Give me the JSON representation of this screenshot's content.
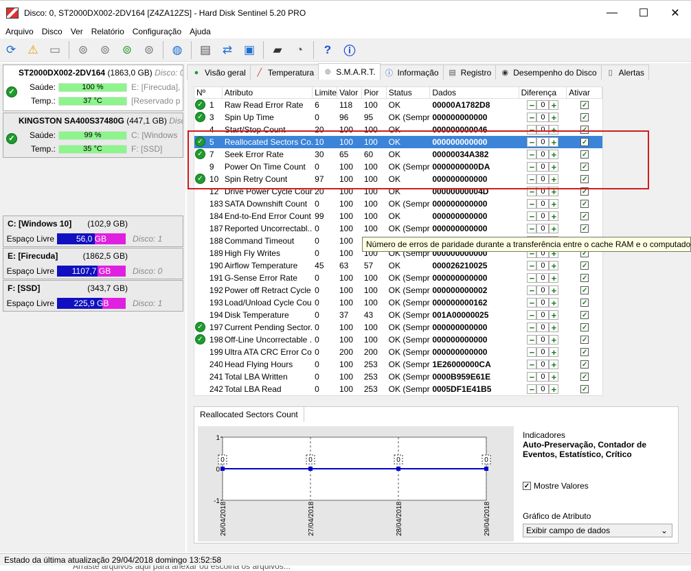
{
  "window": {
    "title": "Disco: 0, ST2000DX002-2DV164 [Z4ZA12ZS]  -  Hard Disk Sentinel 5.20 PRO",
    "minimize": "—",
    "maximize": "☐",
    "close": "✕"
  },
  "menu": [
    "Arquivo",
    "Disco",
    "Ver",
    "Relatório",
    "Configuração",
    "Ajuda"
  ],
  "disks": [
    {
      "name": "ST2000DX002-2DV164",
      "size": "(1863,0 GB)",
      "disk": "Disco: 0",
      "health_label": "Saúde:",
      "health": "100 %",
      "health_extra": "E: [Firecuda],",
      "temp_label": "Temp.:",
      "temp": "37 °C",
      "temp_extra": "[Reservado p"
    },
    {
      "name": "KINGSTON SA400S37480G",
      "size": "(447,1 GB)",
      "disk": "Disco",
      "health_label": "Saúde:",
      "health": "99 %",
      "health_extra": "C: [Windows",
      "temp_label": "Temp.:",
      "temp": "35 °C",
      "temp_extra": "F: [SSD]"
    }
  ],
  "volumes": [
    {
      "name": "C: [Windows 10]",
      "size": "(102,9 GB)",
      "free_label": "Espaço Livre",
      "free": "56,0 GB",
      "disk": "Disco: 1",
      "used_fraction": 0.46
    },
    {
      "name": "E: [Firecuda]",
      "size": "(1862,5 GB)",
      "free_label": "Espaço Livre",
      "free": "1107,7 GB",
      "disk": "Disco: 0",
      "used_fraction": 0.41
    },
    {
      "name": "F: [SSD]",
      "size": "(343,7 GB)",
      "free_label": "Espaço Livre",
      "free": "225,9 GB",
      "disk": "Disco: 1",
      "used_fraction": 0.34
    }
  ],
  "status_text": "Estado da última atualização 29/04/2018 domingo 13:52:58",
  "bottom_text": "Arraste arquivos aqui para anexar ou escolha os arquivos...",
  "tabs": [
    "Visão geral",
    "Temperatura",
    "S.M.A.R.T.",
    "Informação",
    "Registro",
    "Desempenho do Disco",
    "Alertas"
  ],
  "columns": [
    "Nº",
    "Atributo",
    "Limite",
    "Valor",
    "Pior",
    "Status",
    "Dados",
    "Diferença",
    "Ativar"
  ],
  "rows": [
    {
      "n": "1",
      "attr": "Raw Read Error Rate",
      "lim": "6",
      "val": "118",
      "pior": "100",
      "status": "OK",
      "data": "00000A1782D8",
      "ok": true
    },
    {
      "n": "3",
      "attr": "Spin Up Time",
      "lim": "0",
      "val": "96",
      "pior": "95",
      "status": "OK (Sempr...",
      "data": "000000000000",
      "ok": true
    },
    {
      "n": "4",
      "attr": "Start/Stop Count",
      "lim": "20",
      "val": "100",
      "pior": "100",
      "status": "OK",
      "data": "000000000046",
      "ok": false
    },
    {
      "n": "5",
      "attr": "Reallocated Sectors Co...",
      "lim": "10",
      "val": "100",
      "pior": "100",
      "status": "OK",
      "data": "000000000000",
      "ok": true,
      "sel": true
    },
    {
      "n": "7",
      "attr": "Seek Error Rate",
      "lim": "30",
      "val": "65",
      "pior": "60",
      "status": "OK",
      "data": "00000034A382",
      "ok": true
    },
    {
      "n": "9",
      "attr": "Power On Time Count",
      "lim": "0",
      "val": "100",
      "pior": "100",
      "status": "OK (Sempr...",
      "data": "0000000000DA",
      "ok": false
    },
    {
      "n": "10",
      "attr": "Spin Retry Count",
      "lim": "97",
      "val": "100",
      "pior": "100",
      "status": "OK",
      "data": "000000000000",
      "ok": true
    },
    {
      "n": "12",
      "attr": "Drive Power Cycle Count",
      "lim": "20",
      "val": "100",
      "pior": "100",
      "status": "OK",
      "data": "00000000004D",
      "ok": false
    },
    {
      "n": "183",
      "attr": "SATA Downshift Count",
      "lim": "0",
      "val": "100",
      "pior": "100",
      "status": "OK (Sempr...",
      "data": "000000000000",
      "ok": false
    },
    {
      "n": "184",
      "attr": "End-to-End Error Count",
      "lim": "99",
      "val": "100",
      "pior": "100",
      "status": "OK",
      "data": "000000000000",
      "ok": false
    },
    {
      "n": "187",
      "attr": "Reported Uncorrectabl...",
      "lim": "0",
      "val": "100",
      "pior": "100",
      "status": "OK (Sempr...",
      "data": "000000000000",
      "ok": false
    },
    {
      "n": "188",
      "attr": "Command Timeout",
      "lim": "0",
      "val": "100",
      "pior": "",
      "status": "",
      "data": "",
      "ok": false
    },
    {
      "n": "189",
      "attr": "High Fly Writes",
      "lim": "0",
      "val": "100",
      "pior": "100",
      "status": "OK (Sempr...",
      "data": "000000000000",
      "ok": false
    },
    {
      "n": "190",
      "attr": "Airflow Temperature",
      "lim": "45",
      "val": "63",
      "pior": "57",
      "status": "OK",
      "data": "000026210025",
      "ok": false
    },
    {
      "n": "191",
      "attr": "G-Sense Error Rate",
      "lim": "0",
      "val": "100",
      "pior": "100",
      "status": "OK (Sempr...",
      "data": "000000000000",
      "ok": false
    },
    {
      "n": "192",
      "attr": "Power off Retract Cycle ...",
      "lim": "0",
      "val": "100",
      "pior": "100",
      "status": "OK (Sempr...",
      "data": "000000000002",
      "ok": false
    },
    {
      "n": "193",
      "attr": "Load/Unload Cycle Cou...",
      "lim": "0",
      "val": "100",
      "pior": "100",
      "status": "OK (Sempr...",
      "data": "000000000162",
      "ok": false
    },
    {
      "n": "194",
      "attr": "Disk Temperature",
      "lim": "0",
      "val": "37",
      "pior": "43",
      "status": "OK (Sempr...",
      "data": "001A00000025",
      "ok": false
    },
    {
      "n": "197",
      "attr": "Current Pending Sector...",
      "lim": "0",
      "val": "100",
      "pior": "100",
      "status": "OK (Sempr...",
      "data": "000000000000",
      "ok": true
    },
    {
      "n": "198",
      "attr": "Off-Line Uncorrectable ...",
      "lim": "0",
      "val": "100",
      "pior": "100",
      "status": "OK (Sempr...",
      "data": "000000000000",
      "ok": true
    },
    {
      "n": "199",
      "attr": "Ultra ATA CRC Error Co...",
      "lim": "0",
      "val": "200",
      "pior": "200",
      "status": "OK (Sempr...",
      "data": "000000000000",
      "ok": false
    },
    {
      "n": "240",
      "attr": "Head Flying Hours",
      "lim": "0",
      "val": "100",
      "pior": "253",
      "status": "OK (Sempr...",
      "data": "1E26000000CA",
      "ok": false
    },
    {
      "n": "241",
      "attr": "Total LBA Written",
      "lim": "0",
      "val": "100",
      "pior": "253",
      "status": "OK (Sempr...",
      "data": "0000B959E61E",
      "ok": false
    },
    {
      "n": "242",
      "attr": "Total LBA Read",
      "lim": "0",
      "val": "100",
      "pior": "253",
      "status": "OK (Sempr...",
      "data": "0005DF1E41B5",
      "ok": false
    }
  ],
  "tooltip": "Número de erros de paridade durante a transferência entre o cache RAM e o computador.",
  "chart_tab": "Reallocated Sectors Count",
  "indicators_label": "Indicadores",
  "indicators": "Auto-Preservação, Contador de Eventos, Estatístico, Crítico",
  "show_values_label": "Mostre Valores",
  "attr_graph_label": "Gráfico de Atributo",
  "attr_graph_select": "Exibir campo de dados",
  "chart_data": {
    "type": "line",
    "x": [
      "26/04/2018",
      "27/04/2018",
      "28/04/2018",
      "29/04/2018"
    ],
    "values": [
      0,
      0,
      0,
      0
    ],
    "ylim": [
      -1,
      1
    ],
    "yticks": [
      "1",
      "0",
      "-1"
    ],
    "data_labels": [
      "0",
      "0",
      "0",
      "0"
    ],
    "grid": true
  }
}
